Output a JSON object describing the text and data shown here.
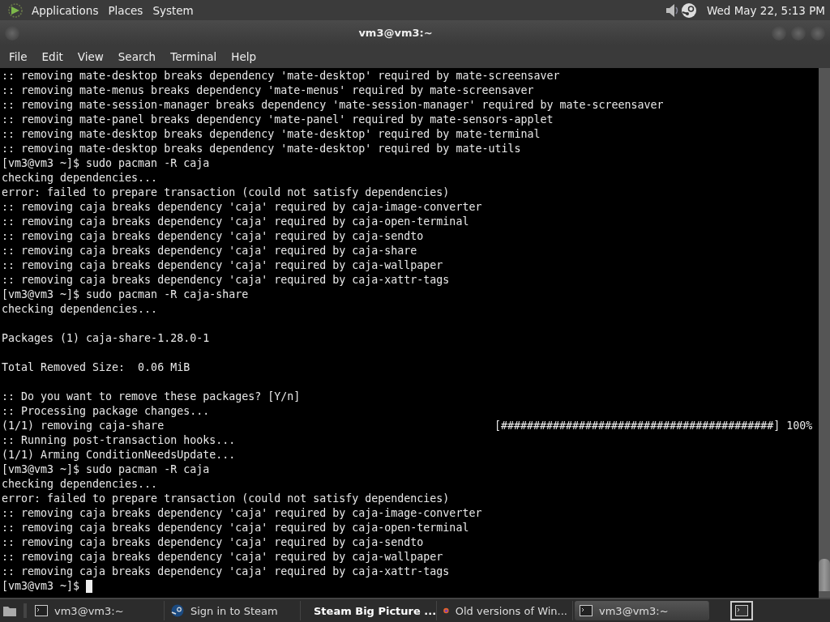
{
  "top_panel": {
    "menus": [
      "Applications",
      "Places",
      "System"
    ],
    "clock": "Wed May 22,  5:13 PM"
  },
  "window": {
    "title": "vm3@vm3:~"
  },
  "menubar": [
    "File",
    "Edit",
    "View",
    "Search",
    "Terminal",
    "Help"
  ],
  "terminal": {
    "lines": [
      {
        "kind": "text",
        "text": ":: removing mate-desktop breaks dependency 'mate-desktop' required by mate-screensaver"
      },
      {
        "kind": "text",
        "text": ":: removing mate-menus breaks dependency 'mate-menus' required by mate-screensaver"
      },
      {
        "kind": "text",
        "text": ":: removing mate-session-manager breaks dependency 'mate-session-manager' required by mate-screensaver"
      },
      {
        "kind": "text",
        "text": ":: removing mate-panel breaks dependency 'mate-panel' required by mate-sensors-applet"
      },
      {
        "kind": "text",
        "text": ":: removing mate-desktop breaks dependency 'mate-desktop' required by mate-terminal"
      },
      {
        "kind": "text",
        "text": ":: removing mate-desktop breaks dependency 'mate-desktop' required by mate-utils"
      },
      {
        "kind": "text",
        "text": "[vm3@vm3 ~]$ sudo pacman -R caja"
      },
      {
        "kind": "text",
        "text": "checking dependencies..."
      },
      {
        "kind": "text",
        "text": "error: failed to prepare transaction (could not satisfy dependencies)"
      },
      {
        "kind": "text",
        "text": ":: removing caja breaks dependency 'caja' required by caja-image-converter"
      },
      {
        "kind": "text",
        "text": ":: removing caja breaks dependency 'caja' required by caja-open-terminal"
      },
      {
        "kind": "text",
        "text": ":: removing caja breaks dependency 'caja' required by caja-sendto"
      },
      {
        "kind": "text",
        "text": ":: removing caja breaks dependency 'caja' required by caja-share"
      },
      {
        "kind": "text",
        "text": ":: removing caja breaks dependency 'caja' required by caja-wallpaper"
      },
      {
        "kind": "text",
        "text": ":: removing caja breaks dependency 'caja' required by caja-xattr-tags"
      },
      {
        "kind": "text",
        "text": "[vm3@vm3 ~]$ sudo pacman -R caja-share"
      },
      {
        "kind": "text",
        "text": "checking dependencies..."
      },
      {
        "kind": "blank"
      },
      {
        "kind": "text",
        "text": "Packages (1) caja-share-1.28.0-1"
      },
      {
        "kind": "blank"
      },
      {
        "kind": "text",
        "text": "Total Removed Size:  0.06 MiB"
      },
      {
        "kind": "blank"
      },
      {
        "kind": "text",
        "text": ":: Do you want to remove these packages? [Y/n]"
      },
      {
        "kind": "text",
        "text": ":: Processing package changes..."
      },
      {
        "kind": "progress",
        "text": "(1/1) removing caja-share",
        "bar": "[##########################################]",
        "percent": "100%"
      },
      {
        "kind": "text",
        "text": ":: Running post-transaction hooks..."
      },
      {
        "kind": "text",
        "text": "(1/1) Arming ConditionNeedsUpdate..."
      },
      {
        "kind": "text",
        "text": "[vm3@vm3 ~]$ sudo pacman -R caja"
      },
      {
        "kind": "text",
        "text": "checking dependencies..."
      },
      {
        "kind": "text",
        "text": "error: failed to prepare transaction (could not satisfy dependencies)"
      },
      {
        "kind": "text",
        "text": ":: removing caja breaks dependency 'caja' required by caja-image-converter"
      },
      {
        "kind": "text",
        "text": ":: removing caja breaks dependency 'caja' required by caja-open-terminal"
      },
      {
        "kind": "text",
        "text": ":: removing caja breaks dependency 'caja' required by caja-sendto"
      },
      {
        "kind": "text",
        "text": ":: removing caja breaks dependency 'caja' required by caja-wallpaper"
      },
      {
        "kind": "text",
        "text": ":: removing caja breaks dependency 'caja' required by caja-xattr-tags"
      },
      {
        "kind": "prompt",
        "text": "[vm3@vm3 ~]$"
      }
    ]
  },
  "taskbar": {
    "windows": [
      {
        "label": "vm3@vm3:~",
        "kind": "terminal",
        "selected": false,
        "attention": false
      },
      {
        "label": "Sign in to Steam",
        "kind": "steam",
        "selected": false,
        "attention": false
      },
      {
        "label": "Steam Big Picture ...",
        "kind": "steam",
        "selected": false,
        "attention": true
      },
      {
        "label": "Old versions of Win...",
        "kind": "browser",
        "selected": false,
        "attention": false
      },
      {
        "label": "vm3@vm3:~",
        "kind": "terminal",
        "selected": true,
        "attention": false
      }
    ]
  }
}
